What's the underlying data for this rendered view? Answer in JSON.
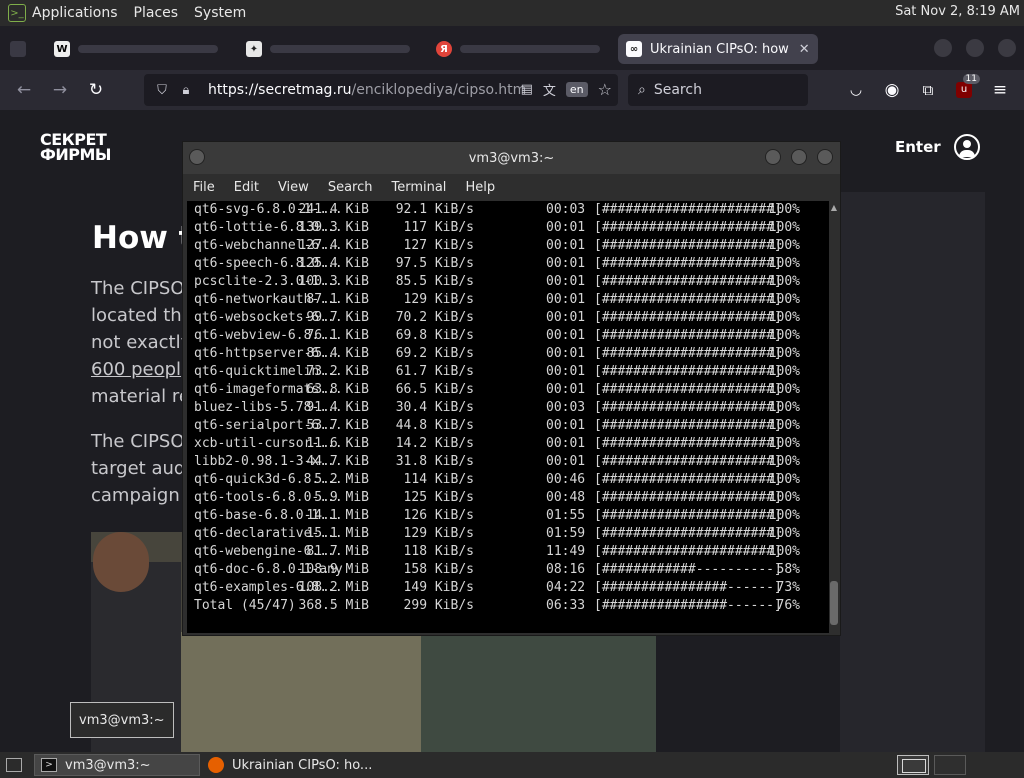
{
  "top_panel": {
    "menus": [
      "Applications",
      "Places",
      "System"
    ],
    "clock": "Sat Nov  2,  8:19 AM"
  },
  "browser": {
    "active_tab_title": "Ukrainian CIPsO: how",
    "url_host": "https://secretmag.ru",
    "url_path": "/enciklopediya/cipso.htm",
    "translate_lang": "en",
    "search_placeholder": "Search",
    "extension_badge": "11"
  },
  "webpage": {
    "logo_line1": "СЕКРЕТ",
    "logo_line2": "ФИРМЫ",
    "enter_label": "Enter",
    "headline": "How t",
    "para1": [
      "The CIPSO",
      "located th",
      "not exactly",
      "600 peopl",
      "material re"
    ],
    "para2": [
      "The CIPSO",
      "target aud",
      "campaign"
    ]
  },
  "terminal": {
    "title": "vm3@vm3:~",
    "menu": [
      "File",
      "Edit",
      "View",
      "Search",
      "Terminal",
      "Help"
    ],
    "lines": [
      [
        "qt6-svg-6.8.0-1-...",
        "241.4 KiB",
        "92.1 KiB/s",
        "00:03",
        "[######################]",
        "100%"
      ],
      [
        "qt6-lottie-6.8.0...",
        "139.3 KiB",
        "117 KiB/s",
        "00:01",
        "[######################]",
        "100%"
      ],
      [
        "qt6-webchannel-6...",
        "127.4 KiB",
        "127 KiB/s",
        "00:01",
        "[######################]",
        "100%"
      ],
      [
        "qt6-speech-6.8.0...",
        "125.4 KiB",
        "97.5 KiB/s",
        "00:01",
        "[######################]",
        "100%"
      ],
      [
        "pcsclite-2.3.0-1...",
        "100.3 KiB",
        "85.5 KiB/s",
        "00:01",
        "[######################]",
        "100%"
      ],
      [
        "qt6-networkauth-...",
        "87.1 KiB",
        "129 KiB/s",
        "00:01",
        "[######################]",
        "100%"
      ],
      [
        "qt6-websockets-6...",
        "99.7 KiB",
        "70.2 KiB/s",
        "00:01",
        "[######################]",
        "100%"
      ],
      [
        "qt6-webview-6.8....",
        "76.1 KiB",
        "69.8 KiB/s",
        "00:01",
        "[######################]",
        "100%"
      ],
      [
        "qt6-httpserver-6...",
        "85.4 KiB",
        "69.2 KiB/s",
        "00:01",
        "[######################]",
        "100%"
      ],
      [
        "qt6-quicktimelin...",
        "73.2 KiB",
        "61.7 KiB/s",
        "00:01",
        "[######################]",
        "100%"
      ],
      [
        "qt6-imageformats...",
        "63.8 KiB",
        "66.5 KiB/s",
        "00:01",
        "[######################]",
        "100%"
      ],
      [
        "bluez-libs-5.78-...",
        "91.4 KiB",
        "30.4 KiB/s",
        "00:03",
        "[######################]",
        "100%"
      ],
      [
        "qt6-serialport-6...",
        "53.7 KiB",
        "44.8 KiB/s",
        "00:01",
        "[######################]",
        "100%"
      ],
      [
        "xcb-util-cursor-...",
        "11.6 KiB",
        "14.2 KiB/s",
        "00:01",
        "[######################]",
        "100%"
      ],
      [
        "libb2-0.98.1-3-x...",
        "44.7 KiB",
        "31.8 KiB/s",
        "00:01",
        "[######################]",
        "100%"
      ],
      [
        "qt6-quick3d-6.8....",
        "5.2 MiB",
        "114 KiB/s",
        "00:46",
        "[######################]",
        "100%"
      ],
      [
        "qt6-tools-6.8.0-...",
        "5.9 MiB",
        "125 KiB/s",
        "00:48",
        "[######################]",
        "100%"
      ],
      [
        "qt6-base-6.8.0-1...",
        "14.1 MiB",
        "126 KiB/s",
        "01:55",
        "[######################]",
        "100%"
      ],
      [
        "qt6-declarative-...",
        "15.1 MiB",
        "129 KiB/s",
        "01:59",
        "[######################]",
        "100%"
      ],
      [
        "qt6-webengine-6....",
        "81.7 MiB",
        "118 KiB/s",
        "11:49",
        "[######################]",
        "100%"
      ],
      [
        "qt6-doc-6.8.0-1-any",
        "108.9 MiB",
        "158 KiB/s",
        "08:16",
        "[############----------]",
        "58%"
      ],
      [
        "qt6-examples-6.8...",
        "108.2 MiB",
        "149 KiB/s",
        "04:22",
        "[################------]",
        "73%"
      ],
      [
        "Total (45/47)",
        "368.5 MiB",
        "299 KiB/s",
        "06:33",
        "[################------]",
        "76%"
      ]
    ]
  },
  "tooltip": "vm3@vm3:~",
  "taskbar": {
    "items": [
      "vm3@vm3:~",
      "Ukrainian CIPsO: ho..."
    ]
  }
}
